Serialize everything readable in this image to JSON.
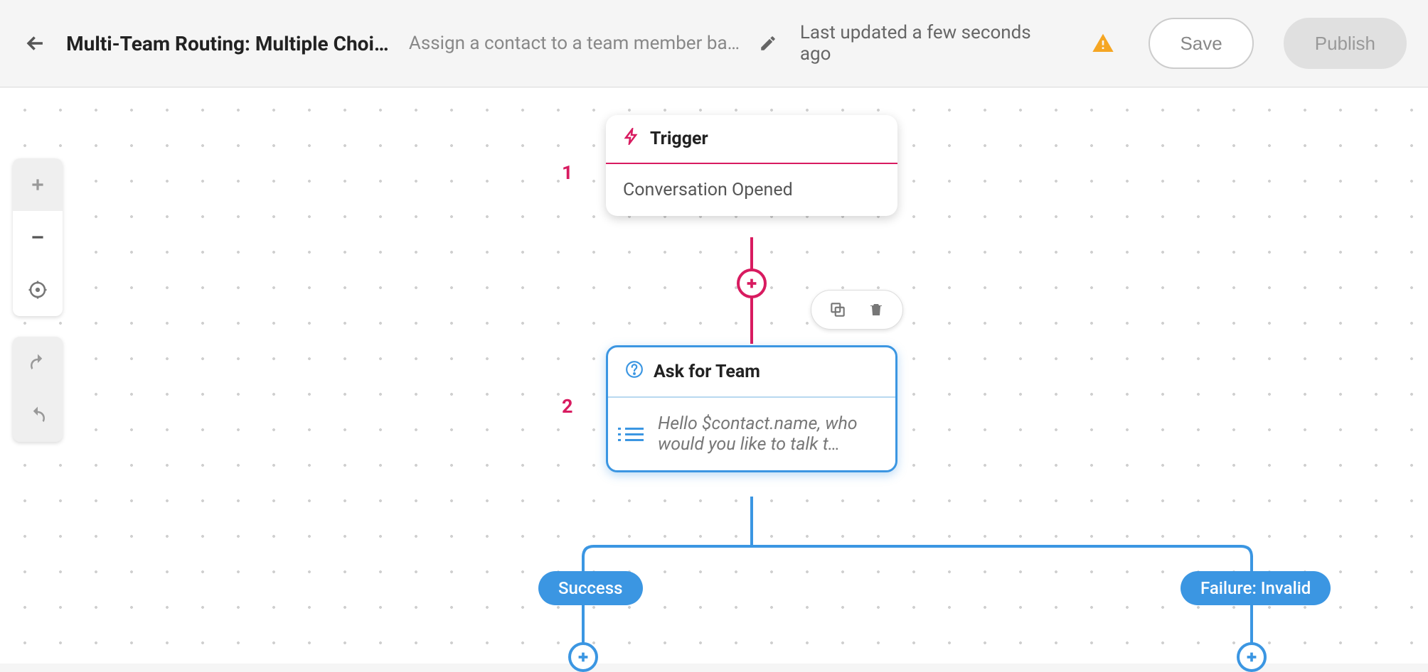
{
  "header": {
    "title": "Multi-Team Routing: Multiple Choic…",
    "subtitle": "Assign a contact to a team member bas…",
    "status": "Last updated a few seconds ago",
    "save_label": "Save",
    "publish_label": "Publish"
  },
  "nodes": {
    "trigger": {
      "number": "1",
      "title": "Trigger",
      "body": "Conversation Opened"
    },
    "ask_team": {
      "number": "2",
      "title": "Ask for Team",
      "body": "Hello $contact.name, who would you like to talk t…"
    }
  },
  "branches": {
    "success": "Success",
    "failure": "Failure: Invalid"
  }
}
